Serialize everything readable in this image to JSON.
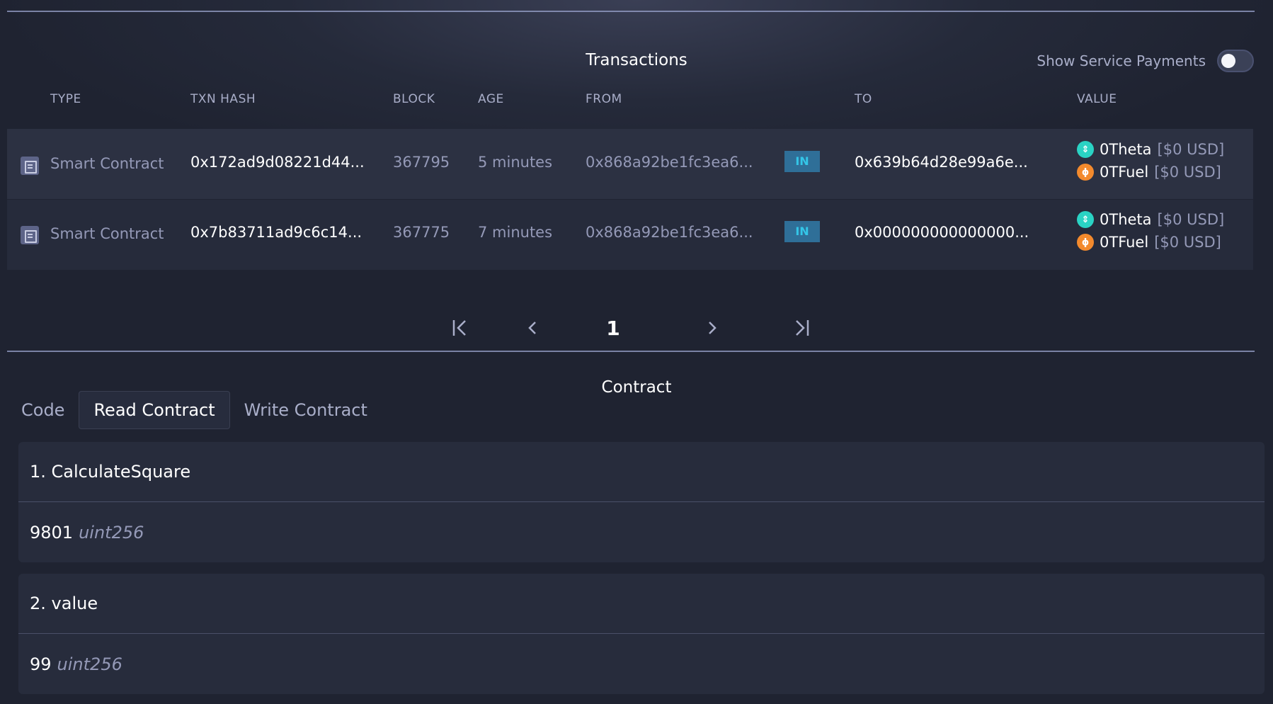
{
  "transactions": {
    "title": "Transactions",
    "service_toggle": {
      "label": "Show Service Payments",
      "on": false
    },
    "columns": [
      "TYPE",
      "TXN HASH",
      "BLOCK",
      "AGE",
      "FROM",
      "",
      "TO",
      "VALUE"
    ],
    "rows": [
      {
        "type": "Smart Contract",
        "hash": "0x172ad9d08221d44...",
        "block": "367795",
        "age": "5 minutes",
        "from": "0x868a92be1fc3ea6...",
        "direction": "IN",
        "to": "0x639b64d28e99a6e...",
        "theta": "0Theta",
        "theta_usd": "[$0 USD]",
        "tfuel": "0TFuel",
        "tfuel_usd": "[$0 USD]"
      },
      {
        "type": "Smart Contract",
        "hash": "0x7b83711ad9c6c14...",
        "block": "367775",
        "age": "7 minutes",
        "from": "0x868a92be1fc3ea6...",
        "direction": "IN",
        "to": "0x000000000000000...",
        "theta": "0Theta",
        "theta_usd": "[$0 USD]",
        "tfuel": "0TFuel",
        "tfuel_usd": "[$0 USD]"
      }
    ],
    "pagination": {
      "current_page": "1"
    }
  },
  "contract": {
    "title": "Contract",
    "tabs": [
      "Code",
      "Read Contract",
      "Write Contract"
    ],
    "active_tab": "Read Contract",
    "functions": [
      {
        "name": "1. CalculateSquare",
        "value": "9801",
        "type": "uint256"
      },
      {
        "name": "2. value",
        "value": "99",
        "type": "uint256"
      }
    ]
  },
  "colors": {
    "background": "#1f2331",
    "row_alt": "#2c3142",
    "badge_bg": "#2f6f98",
    "badge_text": "#34c6e8",
    "theta": "#2ad3c4",
    "tfuel": "#f38a2d"
  },
  "icons": [
    "smart-contract-icon",
    "theta-coin-icon",
    "tfuel-coin-icon",
    "first-page-icon",
    "prev-page-icon",
    "next-page-icon",
    "last-page-icon"
  ]
}
